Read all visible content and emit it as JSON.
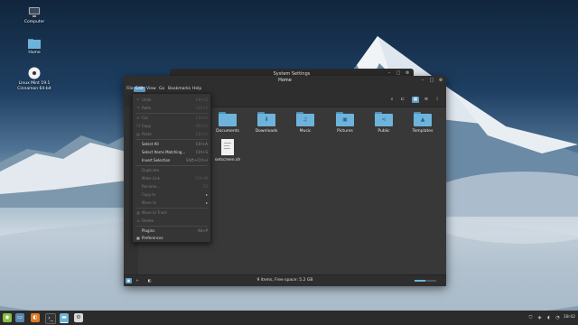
{
  "desktop": {
    "icons": [
      {
        "label": "Computer"
      },
      {
        "label": "Home"
      },
      {
        "label": "Linux Mint 19.1\nCinnamon 64-bit"
      }
    ]
  },
  "back_window": {
    "title": "System Settings"
  },
  "window": {
    "title": "Home",
    "menus": [
      "File",
      "Edit",
      "View",
      "Go",
      "Bookmarks",
      "Help"
    ],
    "active_menu": "Edit",
    "items": [
      {
        "label": "Documents",
        "icon": "folder-icon"
      },
      {
        "label": "Downloads",
        "icon": "download-folder-icon"
      },
      {
        "label": "Music",
        "icon": "music-folder-icon"
      },
      {
        "label": "Pictures",
        "icon": "pictures-folder-icon"
      },
      {
        "label": "Public",
        "icon": "share-folder-icon"
      },
      {
        "label": "Templates",
        "icon": "templates-folder-icon"
      },
      {
        "label": "setscreen.sh",
        "icon": "script-file-icon"
      }
    ],
    "status": "9 items, Free space: 5.2 GB",
    "zoom_level": 0.5
  },
  "edit_menu": {
    "items": [
      {
        "label": "Undo",
        "accel": "Ctrl+Z",
        "enabled": false
      },
      {
        "label": "Redo",
        "accel": "Ctrl+Y",
        "enabled": false
      },
      {
        "label": "Cut",
        "accel": "Ctrl+X",
        "enabled": false
      },
      {
        "label": "Copy",
        "accel": "Ctrl+C",
        "enabled": false
      },
      {
        "label": "Paste",
        "accel": "Ctrl+V",
        "enabled": false
      },
      {
        "label": "Select All",
        "accel": "Ctrl+A",
        "enabled": true
      },
      {
        "label": "Select Items Matching...",
        "accel": "Ctrl+S",
        "enabled": true
      },
      {
        "label": "Invert Selection",
        "accel": "Shift+Ctrl+I",
        "enabled": true
      },
      {
        "label": "Duplicate",
        "accel": "",
        "enabled": false
      },
      {
        "label": "Make Link",
        "accel": "Ctrl+M",
        "enabled": false
      },
      {
        "label": "Rename...",
        "accel": "F2",
        "enabled": false
      },
      {
        "label": "Copy to",
        "accel": "",
        "enabled": false
      },
      {
        "label": "Move to",
        "accel": "",
        "enabled": false
      },
      {
        "label": "Move to Trash",
        "accel": "",
        "enabled": false
      },
      {
        "label": "Delete",
        "accel": "",
        "enabled": false
      },
      {
        "label": "Plugins",
        "accel": "Alt+P",
        "enabled": true
      },
      {
        "label": "Preferences",
        "accel": "",
        "enabled": true
      }
    ]
  },
  "taskbar": {
    "clock": "18:42"
  },
  "colors": {
    "accent": "#5f9ec7",
    "folder": "#6eb3dc",
    "window_bg": "#383838",
    "taskbar": "#2b2b2b"
  }
}
